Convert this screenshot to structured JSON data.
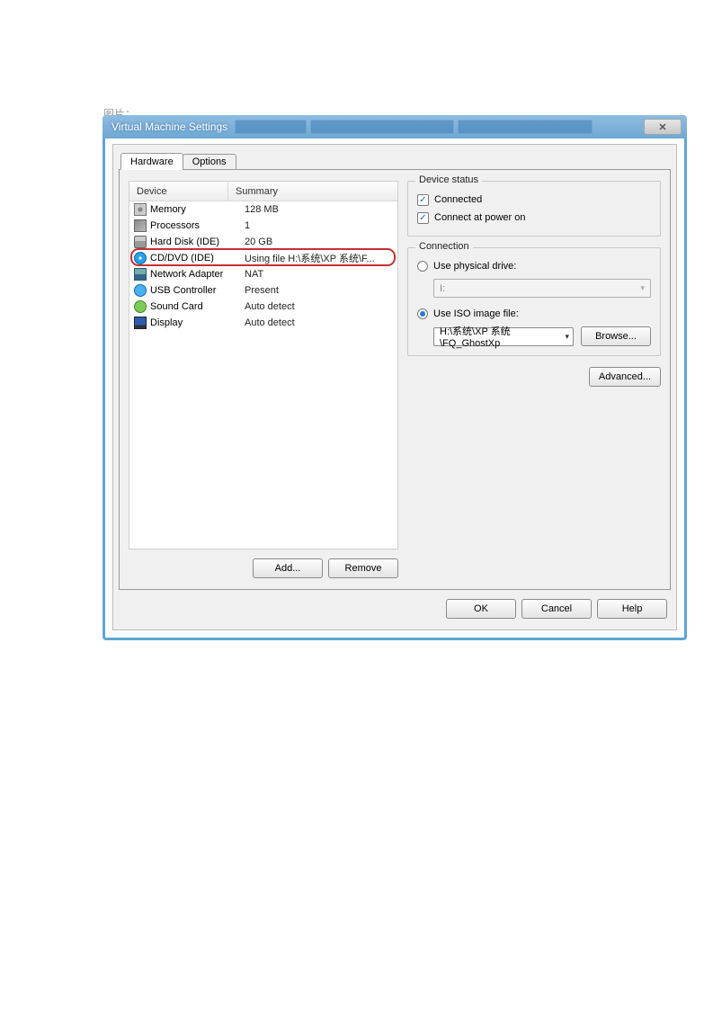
{
  "page_label": "图片：",
  "window": {
    "title": "Virtual Machine Settings"
  },
  "tabs": {
    "hardware": "Hardware",
    "options": "Options"
  },
  "list": {
    "headers": {
      "device": "Device",
      "summary": "Summary"
    },
    "rows": [
      {
        "icon": "memory",
        "name": "Memory",
        "summary": "128 MB"
      },
      {
        "icon": "cpu",
        "name": "Processors",
        "summary": "1"
      },
      {
        "icon": "hdd",
        "name": "Hard Disk (IDE)",
        "summary": "20 GB"
      },
      {
        "icon": "cd",
        "name": "CD/DVD (IDE)",
        "summary": "Using file H:\\系统\\XP 系统\\F...",
        "selected": true
      },
      {
        "icon": "net",
        "name": "Network Adapter",
        "summary": "NAT"
      },
      {
        "icon": "usb",
        "name": "USB Controller",
        "summary": "Present"
      },
      {
        "icon": "snd",
        "name": "Sound Card",
        "summary": "Auto detect"
      },
      {
        "icon": "disp",
        "name": "Display",
        "summary": "Auto detect"
      }
    ],
    "buttons": {
      "add": "Add...",
      "remove": "Remove"
    }
  },
  "status_group": {
    "title": "Device status",
    "connected": "Connected",
    "connect_poweron": "Connect at power on"
  },
  "conn_group": {
    "title": "Connection",
    "physical": "Use physical drive:",
    "physical_value": "I:",
    "iso": "Use ISO image file:",
    "iso_value": "H:\\系统\\XP 系统\\FQ_GhostXp",
    "browse": "Browse...",
    "advanced": "Advanced..."
  },
  "footer": {
    "ok": "OK",
    "cancel": "Cancel",
    "help": "Help"
  }
}
